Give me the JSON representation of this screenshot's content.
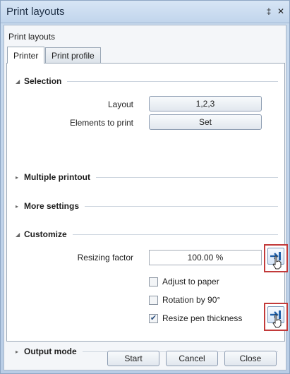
{
  "window": {
    "title": "Print layouts",
    "pin_glyph": "‡",
    "close_glyph": "✕"
  },
  "panel": {
    "label": "Print layouts"
  },
  "tabs": [
    {
      "label": "Printer",
      "active": true
    },
    {
      "label": "Print profile",
      "active": false
    }
  ],
  "sections": {
    "selection": "Selection",
    "multiple_printout": "Multiple printout",
    "more_settings": "More settings",
    "customize": "Customize",
    "output_mode": "Output mode"
  },
  "selection": {
    "layout_label": "Layout",
    "layout_value": "1,2,3",
    "elements_label": "Elements to print",
    "elements_value": "Set"
  },
  "customize": {
    "resizing_label": "Resizing factor",
    "resizing_value": "100.00 %",
    "adjust_to_paper": {
      "label": "Adjust to paper",
      "checked": false
    },
    "rotation": {
      "label": "Rotation by 90°",
      "checked": false
    },
    "resize_pen": {
      "label": "Resize pen thickness",
      "checked": true,
      "check_glyph": "✔"
    }
  },
  "icons": {
    "expanded": "◢",
    "collapsed": "▸",
    "apply_tool": "apply-value-icon"
  },
  "footer": {
    "start": "Start",
    "cancel": "Cancel",
    "close": "Close"
  }
}
